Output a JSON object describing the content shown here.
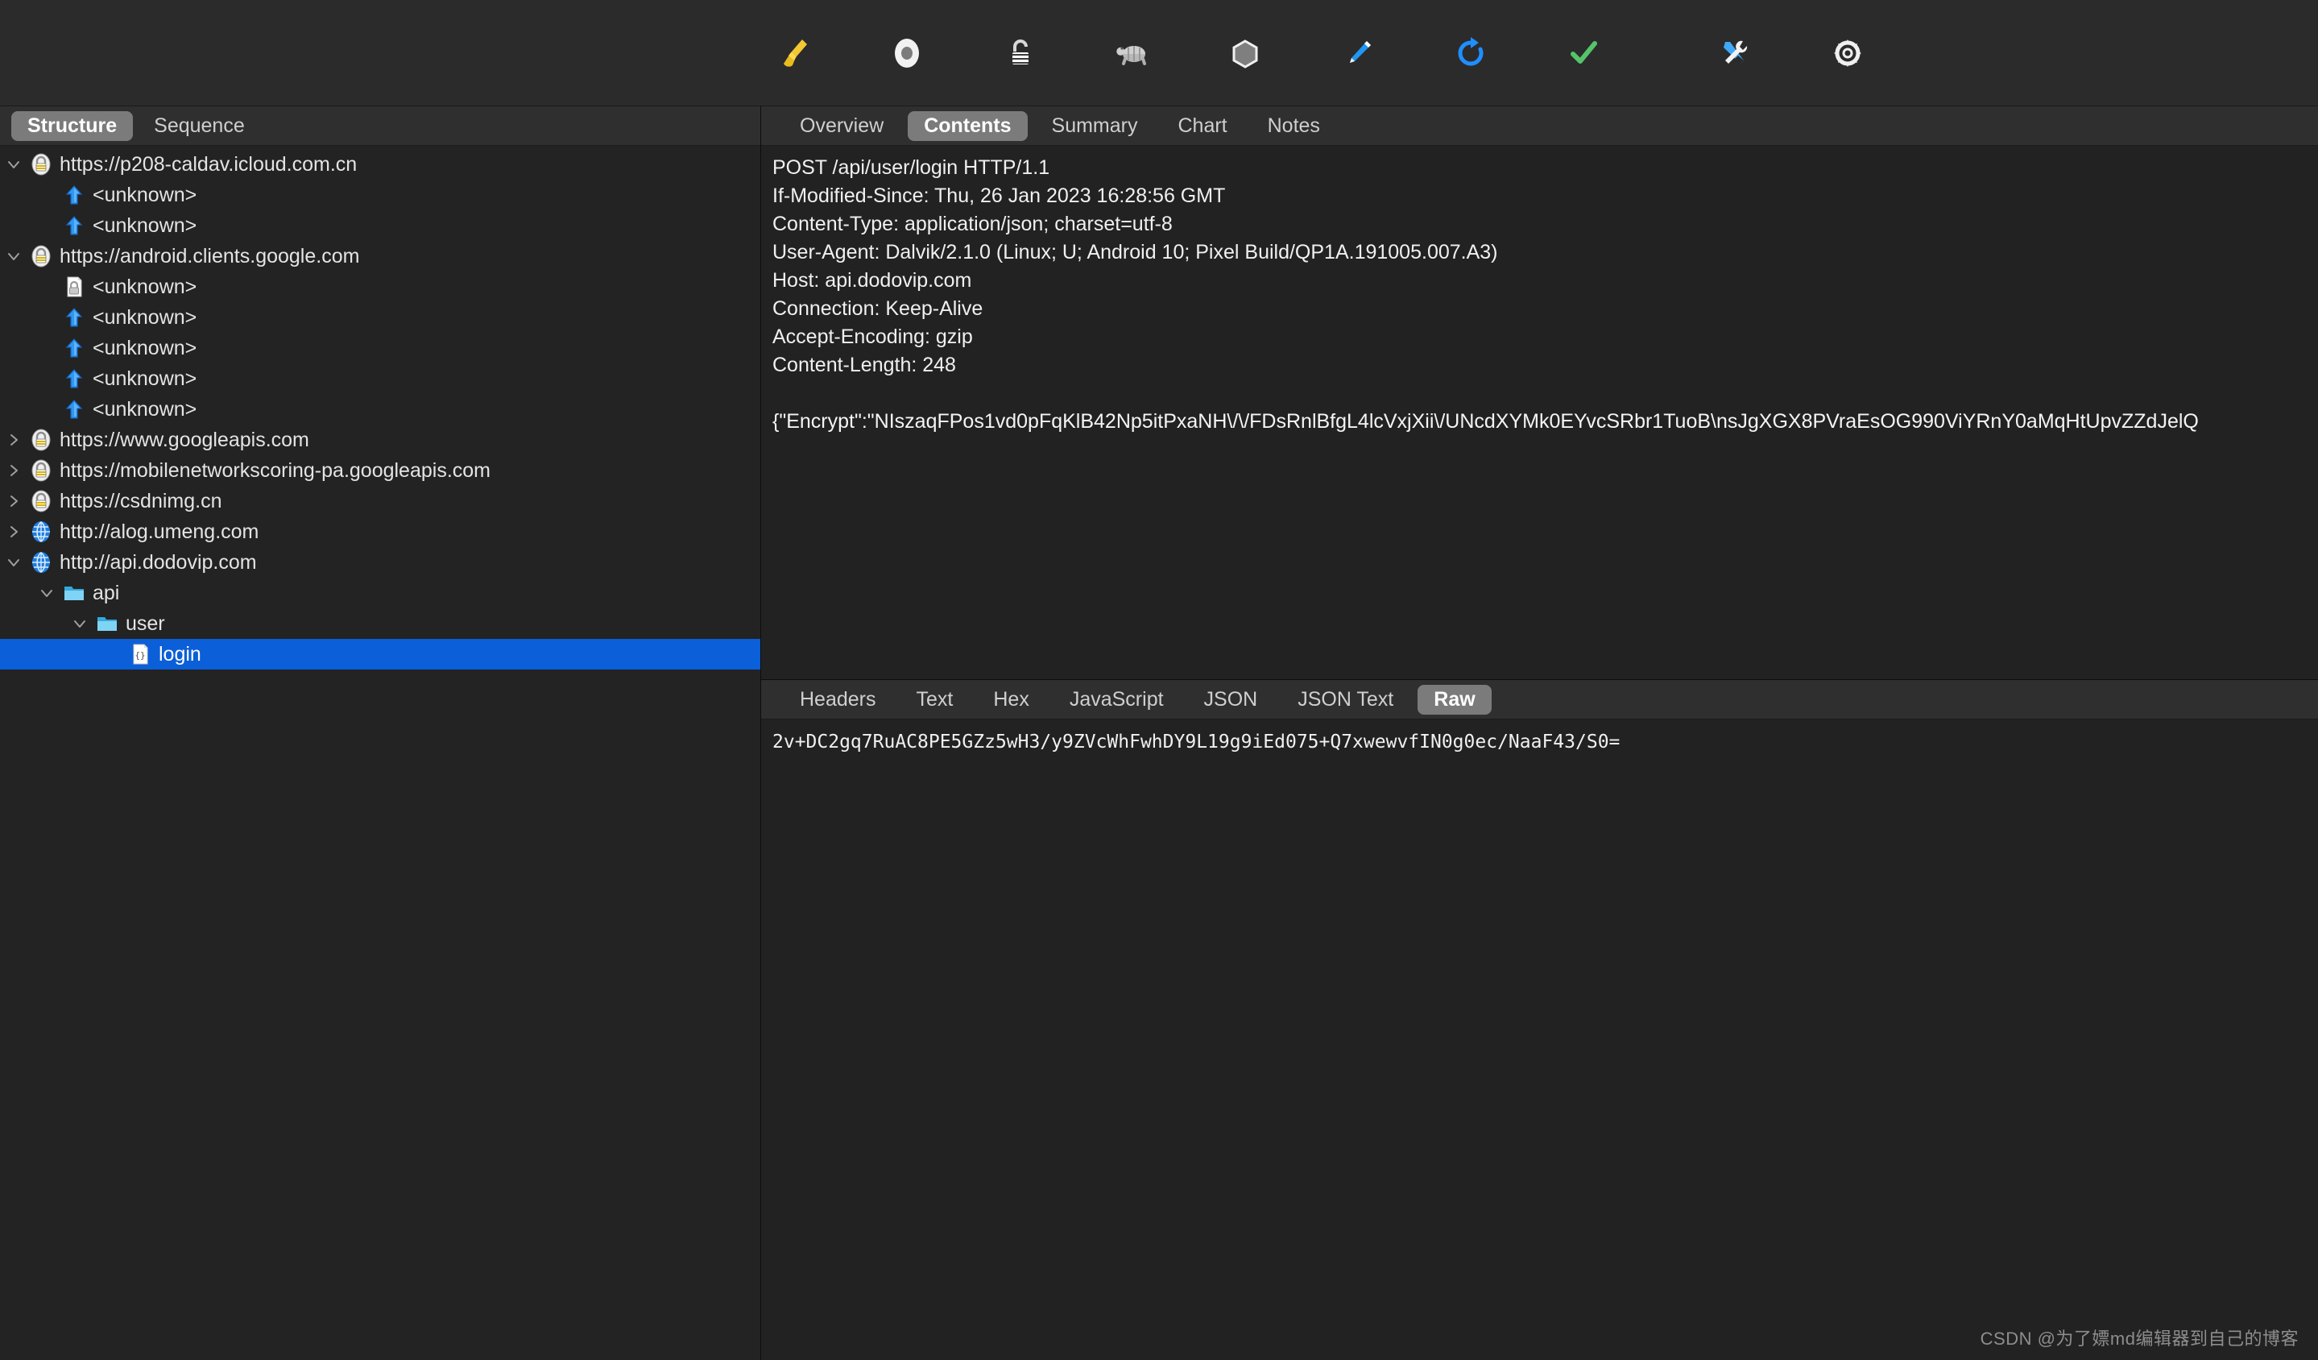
{
  "toolbar": {
    "buttons": [
      {
        "name": "clear-session-button",
        "icon": "broom-icon",
        "title": "Clear"
      },
      {
        "name": "record-button",
        "icon": "record-circle-icon",
        "title": "Start/Stop Recording"
      },
      {
        "name": "ssl-proxying-button",
        "icon": "padlock-icon",
        "title": "SSL Proxying"
      },
      {
        "name": "throttle-button",
        "icon": "turtle-icon",
        "title": "Throttle"
      },
      {
        "name": "breakpoints-button",
        "icon": "hexagon-icon",
        "title": "Breakpoints"
      },
      {
        "name": "compose-button",
        "icon": "pen-icon",
        "title": "Compose"
      },
      {
        "name": "repeat-button",
        "icon": "repeat-arrow-icon",
        "title": "Repeat"
      },
      {
        "name": "validate-button",
        "icon": "checkmark-icon",
        "title": "Validate"
      },
      {
        "name": "tools-button",
        "icon": "tools-icon",
        "title": "Tools"
      },
      {
        "name": "settings-button",
        "icon": "gear-icon",
        "title": "Settings"
      }
    ]
  },
  "left_panel": {
    "tabs": [
      {
        "label": "Structure",
        "active": true
      },
      {
        "label": "Sequence",
        "active": false
      }
    ],
    "tree": [
      {
        "label": "https://p208-caldav.icloud.com.cn",
        "indent": 0,
        "twisty": "down",
        "icon": "lock-ssl-icon",
        "selected": false
      },
      {
        "label": "<unknown>",
        "indent": 1,
        "twisty": "none",
        "icon": "upload-arrow-icon",
        "selected": false
      },
      {
        "label": "<unknown>",
        "indent": 1,
        "twisty": "none",
        "icon": "upload-arrow-icon",
        "selected": false
      },
      {
        "label": "https://android.clients.google.com",
        "indent": 0,
        "twisty": "down",
        "icon": "lock-ssl-icon",
        "selected": false
      },
      {
        "label": "<unknown>",
        "indent": 1,
        "twisty": "none",
        "icon": "locked-document-icon",
        "selected": false
      },
      {
        "label": "<unknown>",
        "indent": 1,
        "twisty": "none",
        "icon": "upload-arrow-icon",
        "selected": false
      },
      {
        "label": "<unknown>",
        "indent": 1,
        "twisty": "none",
        "icon": "upload-arrow-icon",
        "selected": false
      },
      {
        "label": "<unknown>",
        "indent": 1,
        "twisty": "none",
        "icon": "upload-arrow-icon",
        "selected": false
      },
      {
        "label": "<unknown>",
        "indent": 1,
        "twisty": "none",
        "icon": "upload-arrow-icon",
        "selected": false
      },
      {
        "label": "https://www.googleapis.com",
        "indent": 0,
        "twisty": "right",
        "icon": "lock-ssl-icon",
        "selected": false
      },
      {
        "label": "https://mobilenetworkscoring-pa.googleapis.com",
        "indent": 0,
        "twisty": "right",
        "icon": "lock-ssl-icon",
        "selected": false
      },
      {
        "label": "https://csdnimg.cn",
        "indent": 0,
        "twisty": "right",
        "icon": "lock-ssl-icon",
        "selected": false
      },
      {
        "label": "http://alog.umeng.com",
        "indent": 0,
        "twisty": "right",
        "icon": "globe-icon",
        "selected": false
      },
      {
        "label": "http://api.dodovip.com",
        "indent": 0,
        "twisty": "down",
        "icon": "globe-icon",
        "selected": false
      },
      {
        "label": "api",
        "indent": 1,
        "twisty": "down",
        "icon": "folder-icon",
        "selected": false
      },
      {
        "label": "user",
        "indent": 2,
        "twisty": "down",
        "icon": "folder-icon",
        "selected": false
      },
      {
        "label": "login",
        "indent": 3,
        "twisty": "none",
        "icon": "json-document-icon",
        "selected": true
      }
    ]
  },
  "right_panel": {
    "tabs": [
      {
        "label": "Overview",
        "active": false
      },
      {
        "label": "Contents",
        "active": true
      },
      {
        "label": "Summary",
        "active": false
      },
      {
        "label": "Chart",
        "active": false
      },
      {
        "label": "Notes",
        "active": false
      }
    ],
    "request_headers": [
      "POST /api/user/login HTTP/1.1",
      "If-Modified-Since: Thu, 26 Jan 2023 16:28:56 GMT",
      "Content-Type: application/json; charset=utf-8",
      "User-Agent: Dalvik/2.1.0 (Linux; U; Android 10; Pixel Build/QP1A.191005.007.A3)",
      "Host: api.dodovip.com",
      "Connection: Keep-Alive",
      "Accept-Encoding: gzip",
      "Content-Length: 248"
    ],
    "request_body": "{\"Encrypt\":\"NIszaqFPos1vd0pFqKlB42Np5itPxaNH\\/\\/FDsRnlBfgL4lcVxjXii\\/UNcdXYMk0EYvcSRbr1TuoB\\nsJgXGX8PVraEsOG990ViYRnY0aMqHtUpvZZdJelQ",
    "viewer_tabs": [
      {
        "label": "Headers",
        "active": false
      },
      {
        "label": "Text",
        "active": false
      },
      {
        "label": "Hex",
        "active": false
      },
      {
        "label": "JavaScript",
        "active": false
      },
      {
        "label": "JSON",
        "active": false
      },
      {
        "label": "JSON Text",
        "active": false
      },
      {
        "label": "Raw",
        "active": true
      }
    ],
    "raw_content": "2v+DC2gq7RuAC8PE5GZz5wH3/y9ZVcWhFwhDY9L19g9iEd075+Q7xwewvfIN0g0ec/NaaF43/S0="
  },
  "watermark": "CSDN @为了嫖md编辑器到自己的博客",
  "colors": {
    "background": "#232323",
    "toolbar": "#2b2b2b",
    "tabbar": "#2f2f2f",
    "selection_blue": "#0b5fd8",
    "active_tab_pill": "#7b7b7b",
    "text": "#e4e4e4"
  }
}
